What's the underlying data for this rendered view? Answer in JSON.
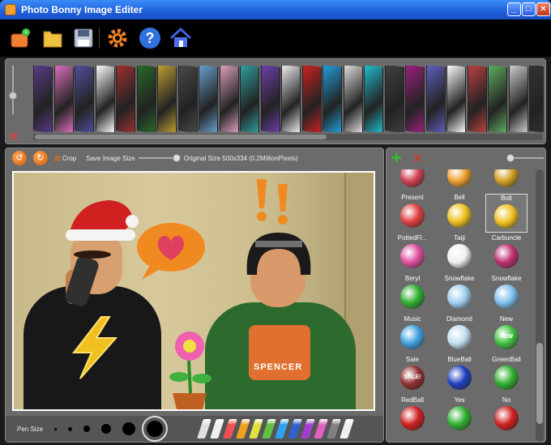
{
  "window": {
    "title": "Photo Bonny Image Editer",
    "buttons": [
      "_",
      "□",
      "×"
    ]
  },
  "toolbar": {
    "icons": [
      "open-icon",
      "folder-icon",
      "save-icon",
      "settings-icon",
      "help-icon",
      "home-icon"
    ]
  },
  "frames": {
    "colors": [
      "#5a3a8a",
      "#e070c0",
      "#5050a0",
      "#ffffff",
      "#a03030",
      "#2a6a2a",
      "#c0a030",
      "#4a4a4a",
      "#6aa0d0",
      "#e0a0c0",
      "#30a0a0",
      "#7040b0",
      "#f0f0f0",
      "#d02020",
      "#20a0e0",
      "#e0e0e0",
      "#20c0d0",
      "#404040",
      "#a02080",
      "#6060c0",
      "#ffffff",
      "#c04040",
      "#60b060",
      "#d0d0d0",
      "#333333"
    ]
  },
  "edit": {
    "crop_label": "Crop",
    "save_image_size_label": "Save Image Size",
    "original_size": "Original Size 500x334 (0.2MillionPixels)"
  },
  "pen": {
    "label": "Pen Size",
    "sizes": [
      3,
      5,
      8,
      12,
      16,
      20
    ],
    "pencil_colors": [
      "#e0e0e0",
      "#f0f0f0",
      "#f05050",
      "#f0a020",
      "#e0e040",
      "#60c040",
      "#30a0f0",
      "#3060d0",
      "#a040d0",
      "#e060c0",
      "#808080",
      "#f0f0f0"
    ]
  },
  "stickers": {
    "items": [
      {
        "name": "",
        "icon": "rose-icon",
        "color": "#d04050"
      },
      {
        "name": "",
        "icon": "butterfly-icon",
        "color": "#f0a030"
      },
      {
        "name": "",
        "icon": "moneybag-icon",
        "color": "#d0a020"
      },
      {
        "name": "Present",
        "icon": "present-icon",
        "color": "#e04040"
      },
      {
        "name": "Bell",
        "icon": "bell-icon",
        "color": "#f0c020"
      },
      {
        "name": "Bolt",
        "icon": "bolt-icon",
        "color": "#f0c020",
        "selected": true
      },
      {
        "name": "PottedFl...",
        "icon": "potted-flower-icon",
        "color": "#e050a0"
      },
      {
        "name": "Taiji",
        "icon": "taiji-icon",
        "color": "#f0f0f0"
      },
      {
        "name": "Carbuncle",
        "icon": "carbuncle-icon",
        "color": "#c03070"
      },
      {
        "name": "Beryl",
        "icon": "beryl-icon",
        "color": "#30b030"
      },
      {
        "name": "Snowflake",
        "icon": "snowflake-icon",
        "color": "#a0d0f0"
      },
      {
        "name": "Snowflake",
        "icon": "snowflake-icon",
        "color": "#80c0f0"
      },
      {
        "name": "Music",
        "icon": "music-icon",
        "color": "#40a0e0"
      },
      {
        "name": "Diamond",
        "icon": "diamond-icon",
        "color": "#c0e0f0"
      },
      {
        "name": "New",
        "icon": "new-badge-icon",
        "color": "#40c040"
      },
      {
        "name": "Sale",
        "icon": "sale-badge-icon",
        "color": "#903030"
      },
      {
        "name": "BlueBall",
        "icon": "blue-ball-icon",
        "color": "#2040c0"
      },
      {
        "name": "GreenBall",
        "icon": "green-ball-icon",
        "color": "#30b030"
      },
      {
        "name": "RedBall",
        "icon": "red-ball-icon",
        "color": "#d02020"
      },
      {
        "name": "Yes",
        "icon": "yes-check-icon",
        "color": "#30b030"
      },
      {
        "name": "No",
        "icon": "no-cross-icon",
        "color": "#d02020"
      }
    ]
  },
  "photo": {
    "shirt_text": "SPENCER",
    "badge_new": "NEW",
    "badge_sale": "SALE!"
  }
}
